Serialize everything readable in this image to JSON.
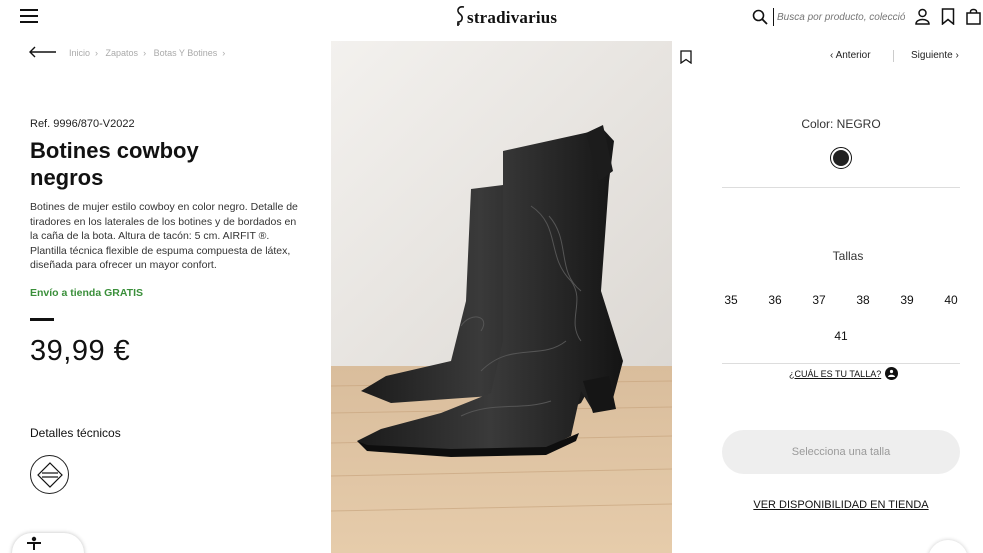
{
  "header": {
    "logo": "stradivarius",
    "search_placeholder": "Busca por producto, colección..."
  },
  "breadcrumb": [
    "Inicio",
    "Zapatos",
    "Botas Y Botines"
  ],
  "product": {
    "ref": "Ref. 9996/870-V2022",
    "title": "Botines cowboy negros",
    "description": "Botines de mujer estilo cowboy en color negro. Detalle de tiradores en los laterales de los botines y de bordados en la caña de la bota. Altura de tacón: 5 cm. AIRFIT ®. Plantilla técnica flexible de espuma compuesta de látex, diseñada para ofrecer un mayor confort.",
    "shipping": "Envío a tienda GRATIS",
    "price": "39,99 €",
    "details_label": "Detalles técnicos"
  },
  "nav": {
    "prev": "Anterior",
    "next": "Siguiente"
  },
  "color": {
    "label": "Color: NEGRO",
    "swatch": "#222222"
  },
  "sizes": {
    "label": "Tallas",
    "items": [
      "35",
      "36",
      "37",
      "38",
      "39",
      "40",
      "41"
    ],
    "guide": "¿CUÁL ES TU TALLA?"
  },
  "actions": {
    "select_size": "Selecciona una talla",
    "store_availability": "VER DISPONIBILIDAD EN TIENDA"
  },
  "colors": {
    "shipping_green": "#3a8f3a",
    "button_bg": "#eeeeee"
  }
}
